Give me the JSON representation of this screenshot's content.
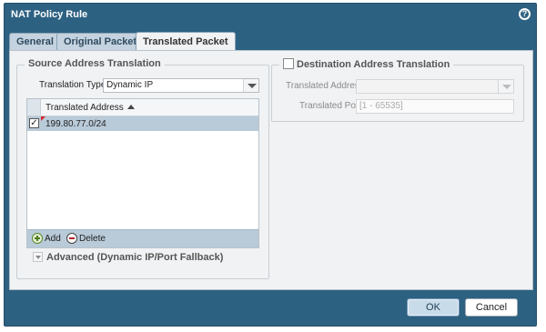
{
  "dialog": {
    "title": "NAT Policy Rule",
    "help_icon": "question-mark-icon"
  },
  "tabs": [
    {
      "label": "General",
      "active": false
    },
    {
      "label": "Original Packet",
      "active": false
    },
    {
      "label": "Translated Packet",
      "active": true
    }
  ],
  "source_translation": {
    "legend": "Source Address Translation",
    "type_label": "Translation Type",
    "type_value": "Dynamic IP",
    "grid": {
      "column_header": "Translated Address",
      "rows": [
        {
          "checked": true,
          "value": "199.80.77.0/24"
        }
      ],
      "toolbar": {
        "add_label": "Add",
        "delete_label": "Delete"
      }
    },
    "advanced_label": "Advanced (Dynamic IP/Port Fallback)"
  },
  "destination_translation": {
    "legend": "Destination Address Translation",
    "enabled": false,
    "address_label": "Translated Address",
    "address_value": "",
    "port_label": "Translated Port",
    "port_placeholder": "[1 - 65535]"
  },
  "footer": {
    "ok_label": "OK",
    "cancel_label": "Cancel"
  },
  "colors": {
    "dialog_bg": "#2d6182",
    "content_bg": "#f0f2f4",
    "selected_row": "#b9cad8",
    "ok_button": "#c8dbe9"
  }
}
